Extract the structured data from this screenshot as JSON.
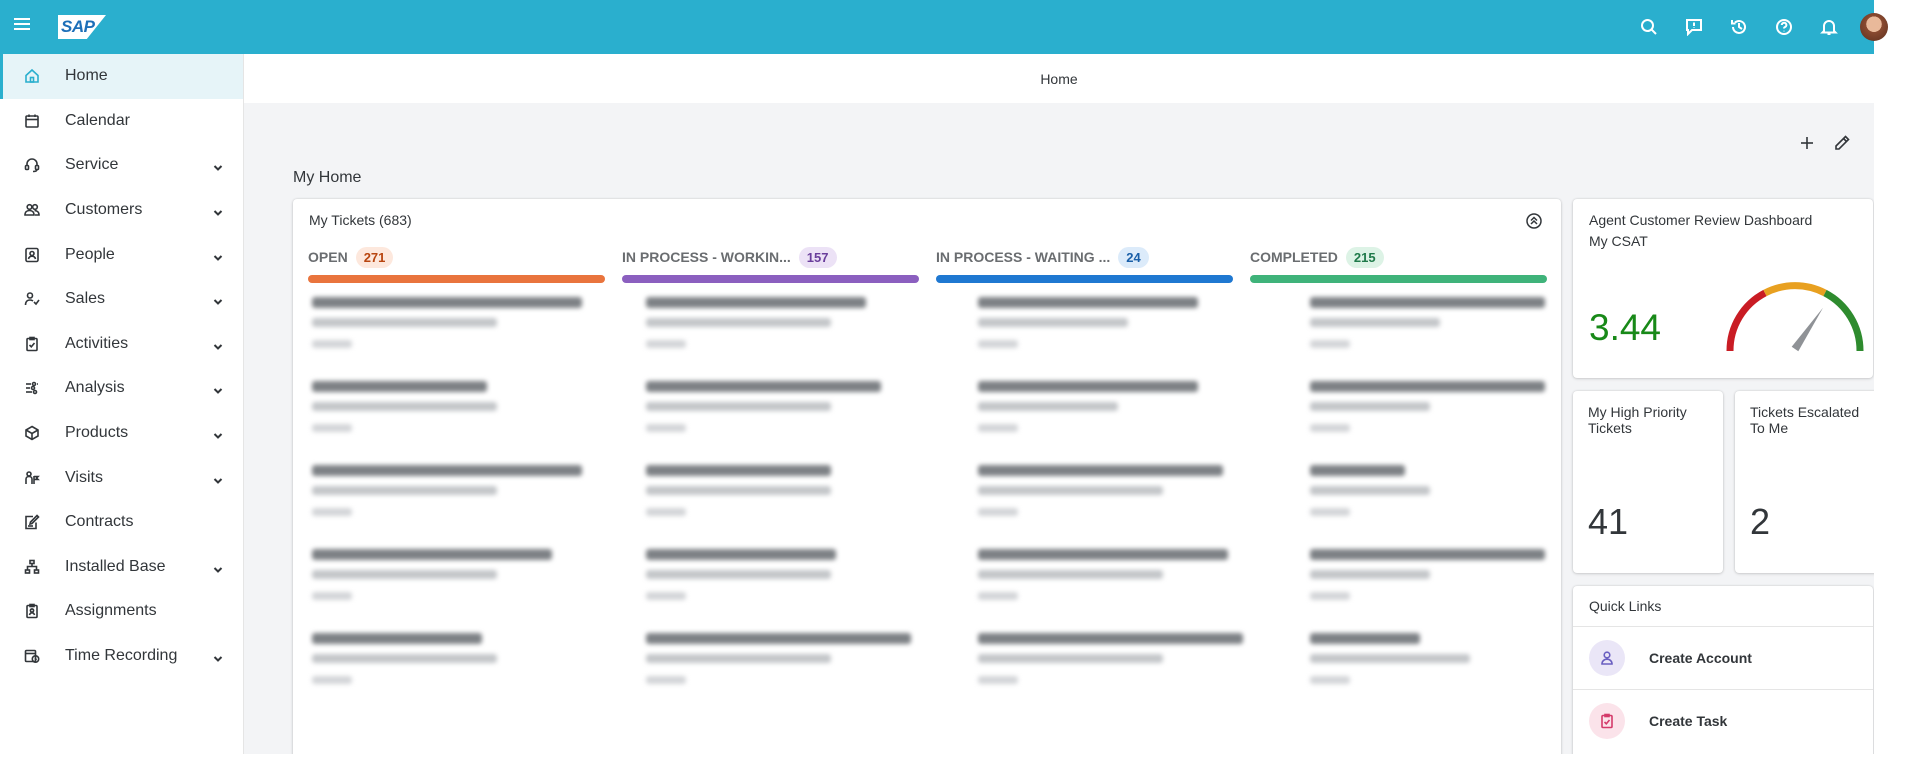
{
  "shell": {
    "logo": "SAP",
    "icons": [
      "search-icon",
      "feedback-icon",
      "history-icon",
      "help-icon",
      "notifications-icon"
    ],
    "brand_color": "#2aafce"
  },
  "sidebar": {
    "items": [
      {
        "label": "Home",
        "icon": "home-icon",
        "active": true,
        "expandable": false
      },
      {
        "label": "Calendar",
        "icon": "calendar-icon",
        "expandable": false
      },
      {
        "label": "Service",
        "icon": "headset-icon",
        "expandable": true
      },
      {
        "label": "Customers",
        "icon": "customers-icon",
        "expandable": true
      },
      {
        "label": "People",
        "icon": "people-icon",
        "expandable": true
      },
      {
        "label": "Sales",
        "icon": "sales-icon",
        "expandable": true
      },
      {
        "label": "Activities",
        "icon": "activities-icon",
        "expandable": true
      },
      {
        "label": "Analysis",
        "icon": "analysis-icon",
        "expandable": true
      },
      {
        "label": "Products",
        "icon": "products-icon",
        "expandable": true
      },
      {
        "label": "Visits",
        "icon": "visits-icon",
        "expandable": true
      },
      {
        "label": "Contracts",
        "icon": "contracts-icon",
        "expandable": false
      },
      {
        "label": "Installed Base",
        "icon": "installed-base-icon",
        "expandable": true
      },
      {
        "label": "Assignments",
        "icon": "assignments-icon",
        "expandable": false
      },
      {
        "label": "Time Recording",
        "icon": "time-recording-icon",
        "expandable": true
      }
    ]
  },
  "main": {
    "page_title": "Home",
    "section_title": "My Home",
    "actions": [
      "add-icon",
      "edit-icon"
    ]
  },
  "tickets": {
    "title": "My Tickets (683)",
    "columns": [
      {
        "name": "OPEN",
        "count": "271",
        "color": "#e9743d",
        "badge_bg": "#fde8dd",
        "badge_fg": "#b8450f"
      },
      {
        "name": "IN PROCESS - WORKIN...",
        "count": "157",
        "color": "#8b5fbf",
        "badge_bg": "#ece2f6",
        "badge_fg": "#6a3e9c"
      },
      {
        "name": "IN PROCESS - WAITING ...",
        "count": "24",
        "color": "#1f78d1",
        "badge_bg": "#dcebfa",
        "badge_fg": "#1a5fa8"
      },
      {
        "name": "COMPLETED",
        "count": "215",
        "color": "#3fb37a",
        "badge_bg": "#ddf3e6",
        "badge_fg": "#1f7a4a"
      }
    ]
  },
  "csat": {
    "title": "Agent Customer Review Dashboard",
    "subtitle": "My CSAT",
    "value": "3.44",
    "value_color": "#188918",
    "gauge_fraction": 0.69
  },
  "kpis": [
    {
      "title": "My High Priority Tickets",
      "value": "41"
    },
    {
      "title": "Tickets Escalated To Me",
      "value": "2"
    }
  ],
  "quick_links": {
    "title": "Quick Links",
    "items": [
      {
        "label": "Create Account",
        "icon": "account-icon",
        "bg": "#eae6f7",
        "fg": "#6a5fc1"
      },
      {
        "label": "Create Task",
        "icon": "task-icon",
        "bg": "#fbe3ea",
        "fg": "#d43a6a"
      }
    ]
  }
}
